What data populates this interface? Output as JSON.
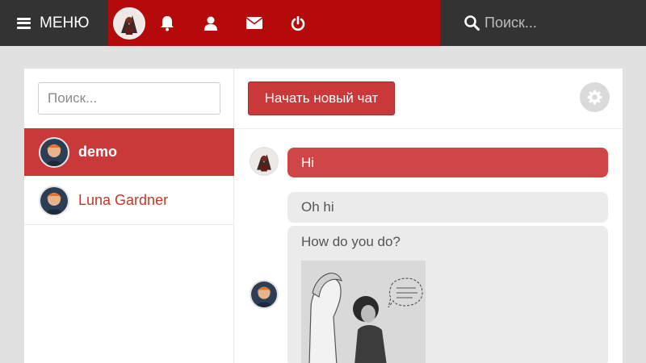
{
  "topbar": {
    "menu_label": "МЕНЮ",
    "search_placeholder": "Поиск...",
    "icons": [
      "bell-icon",
      "user-icon",
      "envelope-icon",
      "power-icon"
    ],
    "colors": {
      "dark": "#333333",
      "brand_red": "#b40a0a"
    }
  },
  "sidebar": {
    "search_placeholder": "Поиск...",
    "contacts": [
      {
        "name": "demo",
        "active": true
      },
      {
        "name": "Luna Gardner",
        "active": false
      }
    ]
  },
  "chat": {
    "new_chat_label": "Начать новый чат",
    "messages": [
      {
        "from": "me",
        "text": "Hi"
      },
      {
        "from": "other",
        "text": "Oh hi"
      },
      {
        "from": "other",
        "text": "How do you do?",
        "has_image": true
      }
    ]
  },
  "colors": {
    "accent": "#c9393a",
    "bubble_other": "#ebebeb"
  }
}
